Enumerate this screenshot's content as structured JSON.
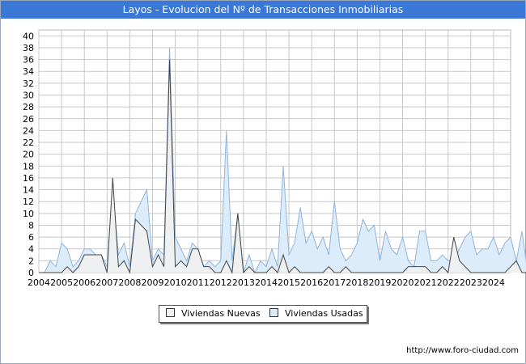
{
  "window": {
    "title": "Layos - Evolucion del Nº de Transacciones Inmobiliarias"
  },
  "footer": {
    "url": "http://www.foro-ciudad.com"
  },
  "colors": {
    "nuevas_fill": "#f1f1f1",
    "nuevas_line": "#444444",
    "usadas_fill": "#dcecfb",
    "usadas_line": "#8fb4de",
    "grid": "#c8c8c8",
    "title_bg": "#3b77d6"
  },
  "chart_data": {
    "type": "area",
    "title": "Layos - Evolucion del Nº de Transacciones Inmobiliarias",
    "xlabel": "",
    "ylabel": "",
    "xlim": [
      2004,
      2024.75
    ],
    "ylim": [
      0,
      41
    ],
    "yticks": [
      0,
      2,
      4,
      6,
      8,
      10,
      12,
      14,
      16,
      18,
      20,
      22,
      24,
      26,
      28,
      30,
      32,
      34,
      36,
      38,
      40
    ],
    "xticks": [
      2004,
      2005,
      2006,
      2007,
      2008,
      2009,
      2010,
      2011,
      2012,
      2013,
      2014,
      2015,
      2016,
      2017,
      2018,
      2019,
      2020,
      2021,
      2022,
      2023,
      2024
    ],
    "grid": true,
    "legend_position": "bottom-center",
    "x_step_quarter": 0.25,
    "series": [
      {
        "name": "Viviendas Nuevas",
        "values": [
          0,
          0,
          0,
          0,
          0,
          1,
          0,
          1,
          3,
          3,
          3,
          3,
          0,
          16,
          1,
          2,
          0,
          9,
          8,
          7,
          1,
          3,
          1,
          36,
          1,
          2,
          1,
          4,
          4,
          1,
          1,
          0,
          0,
          2,
          0,
          10,
          0,
          1,
          0,
          0,
          0,
          1,
          0,
          3,
          0,
          1,
          0,
          0,
          0,
          0,
          0,
          1,
          0,
          0,
          1,
          0,
          0,
          0,
          0,
          0,
          0,
          0,
          0,
          0,
          0,
          1,
          1,
          1,
          1,
          0,
          0,
          1,
          0,
          6,
          2,
          1,
          0,
          0,
          0,
          0,
          0,
          0,
          0,
          1,
          2,
          0,
          0,
          0,
          1,
          0,
          2,
          1,
          0,
          2,
          0,
          0
        ]
      },
      {
        "name": "Viviendas Usadas",
        "values": [
          0,
          0,
          2,
          1,
          5,
          4,
          1,
          2,
          4,
          4,
          3,
          3,
          1,
          14,
          3,
          5,
          1,
          10,
          12,
          14,
          2,
          4,
          3,
          38,
          6,
          4,
          2,
          5,
          4,
          1,
          2,
          1,
          2,
          24,
          2,
          10,
          0,
          3,
          0,
          2,
          1,
          4,
          1,
          18,
          3,
          5,
          11,
          5,
          7,
          4,
          6,
          3,
          12,
          4,
          2,
          3,
          5,
          9,
          7,
          8,
          2,
          7,
          4,
          3,
          6,
          2,
          1,
          7,
          7,
          2,
          2,
          3,
          2,
          2,
          4,
          6,
          7,
          3,
          4,
          4,
          6,
          3,
          5,
          6,
          2,
          7,
          0,
          2,
          7
        ]
      }
    ]
  }
}
